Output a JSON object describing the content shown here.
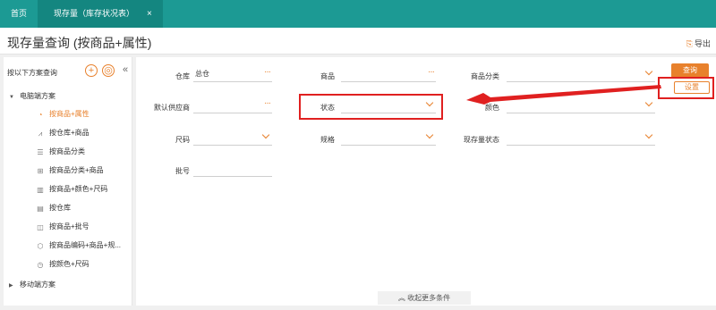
{
  "tabs": {
    "home": "首页",
    "active": "现存量（库存状况表）",
    "close": "×"
  },
  "header": {
    "title": "现存量查询 (按商品+属性)",
    "export_label": "导出"
  },
  "sidebar": {
    "heading": "按以下方案查询",
    "add_symbol": "+",
    "settings_symbol": "◎",
    "collapse_symbol": "«",
    "groups": [
      {
        "label": "电脑端方案",
        "expanded": true
      },
      {
        "label": "移动端方案",
        "expanded": false
      }
    ],
    "items": [
      {
        "label": "按商品+属性",
        "icon": "clock-icon",
        "active": true
      },
      {
        "label": "按仓库+商品",
        "icon": "line-chart-icon",
        "active": false
      },
      {
        "label": "按商品分类",
        "icon": "list-icon",
        "active": false
      },
      {
        "label": "按商品分类+商品",
        "icon": "grid-icon",
        "active": false
      },
      {
        "label": "按商品+颜色+尺码",
        "icon": "bar-chart-icon",
        "active": false
      },
      {
        "label": "按仓库",
        "icon": "table-icon",
        "active": false
      },
      {
        "label": "按商品+批号",
        "icon": "area-chart-icon",
        "active": false
      },
      {
        "label": "按商品编码+商品+规...",
        "icon": "cube-icon",
        "active": false
      },
      {
        "label": "按颜色+尺码",
        "icon": "clock-icon",
        "active": false
      }
    ]
  },
  "form": {
    "warehouse": {
      "label": "仓库",
      "value": "总仓"
    },
    "product": {
      "label": "商品",
      "value": ""
    },
    "category": {
      "label": "商品分类",
      "value": ""
    },
    "supplier": {
      "label": "默认供应商",
      "value": ""
    },
    "status": {
      "label": "状态",
      "value": ""
    },
    "color": {
      "label": "颜色",
      "value": ""
    },
    "size": {
      "label": "尺码",
      "value": ""
    },
    "spec": {
      "label": "规格",
      "value": ""
    },
    "stock_status": {
      "label": "现存量状态",
      "value": ""
    },
    "batch": {
      "label": "批号",
      "value": ""
    },
    "query_button": "查询",
    "settings_button": "设置",
    "more_conditions": "收起更多条件"
  },
  "colors": {
    "tabbar": "#1c9a94",
    "accent": "#e8812c",
    "highlight": "#e02020"
  }
}
